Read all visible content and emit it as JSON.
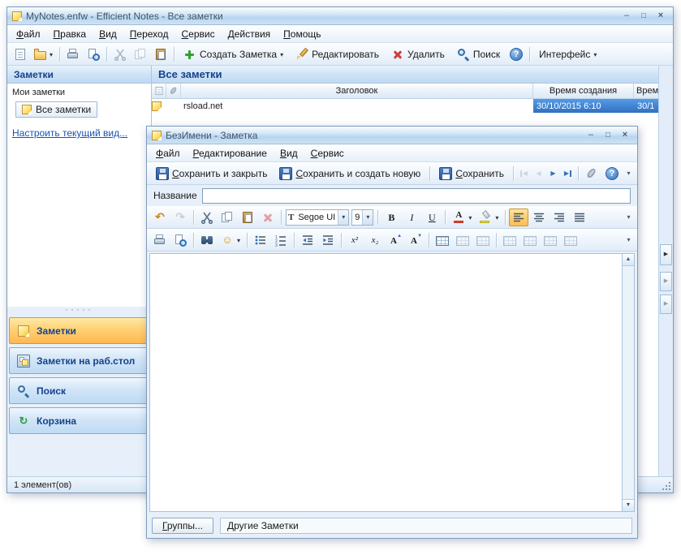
{
  "main": {
    "title": "MyNotes.enfw - Efficient Notes - Все заметки",
    "menu": [
      "Файл",
      "Правка",
      "Вид",
      "Переход",
      "Сервис",
      "Действия",
      "Помощь"
    ],
    "toolbar": {
      "create": "Создать Заметка",
      "edit": "Редактировать",
      "delete": "Удалить",
      "search": "Поиск",
      "interface": "Интерфейс"
    },
    "sidebar": {
      "header": "Заметки",
      "root": "Мои заметки",
      "selected": "Все заметки",
      "link": "Настроить текущий вид...",
      "nav": [
        {
          "label": "Заметки"
        },
        {
          "label": "Заметки на раб.стол"
        },
        {
          "label": "Поиск"
        },
        {
          "label": "Корзина"
        }
      ]
    },
    "list": {
      "header": "Все заметки",
      "columns": {
        "title": "Заголовок",
        "created": "Время создания",
        "modified": "Врем"
      },
      "row": {
        "title": "rsload.net",
        "created": "30/10/2015 6:10",
        "modified": "30/1"
      }
    },
    "status": "1 элемент(ов)"
  },
  "note": {
    "title": "БезИмени - Заметка",
    "menu": [
      "Файл",
      "Редактирование",
      "Вид",
      "Сервис"
    ],
    "toolbar": {
      "save_close": "Сохранить и закрыть",
      "save_new": "Сохранить и создать новую",
      "save": "Сохранить"
    },
    "name_label": "Название",
    "name_value": "",
    "font_name": "Segoe UI",
    "font_size": "9",
    "body_text": "",
    "footer": {
      "groups": "Группы...",
      "group_value": "Другие Заметки"
    }
  },
  "colors": {
    "titlebar_blue": "#B7D5F0",
    "active_nav_orange": "#FFB850",
    "selection_blue": "#3E7FD4",
    "header_text_blue": "#15428B",
    "link_blue": "#1553B5",
    "note_yellow": "#FFE27A"
  },
  "icons": {
    "app_icon": "sticky-note",
    "new_note": "blank-page",
    "open": "folder",
    "print": "printer",
    "print_preview": "page-with-magnifier",
    "cut": "scissors",
    "copy": "two-pages",
    "paste": "clipboard",
    "create_note": "green-plus",
    "edit": "pencil",
    "delete": "red-x",
    "search": "magnifier",
    "help": "blue-question-circle",
    "attachment": "paperclip",
    "save": "floppy-disk",
    "undo": "curved-arrow-left",
    "redo": "curved-arrow-right",
    "font_color": "letter-a-with-red-bar",
    "highlighter": "highlighter-pen",
    "align": "text-align-lines",
    "bullets": "bullet-list",
    "numbering": "numbered-list",
    "outdent": "decrease-indent",
    "indent": "increase-indent",
    "superscript": "x-squared",
    "subscript": "x-sub-two",
    "grow_font": "a-up-arrow",
    "shrink_font": "a-down-arrow",
    "table": "grid",
    "smiley": "smiley-face",
    "find": "binoculars",
    "desktop_notes": "note-on-monitor",
    "trash": "recycle-arrows"
  }
}
